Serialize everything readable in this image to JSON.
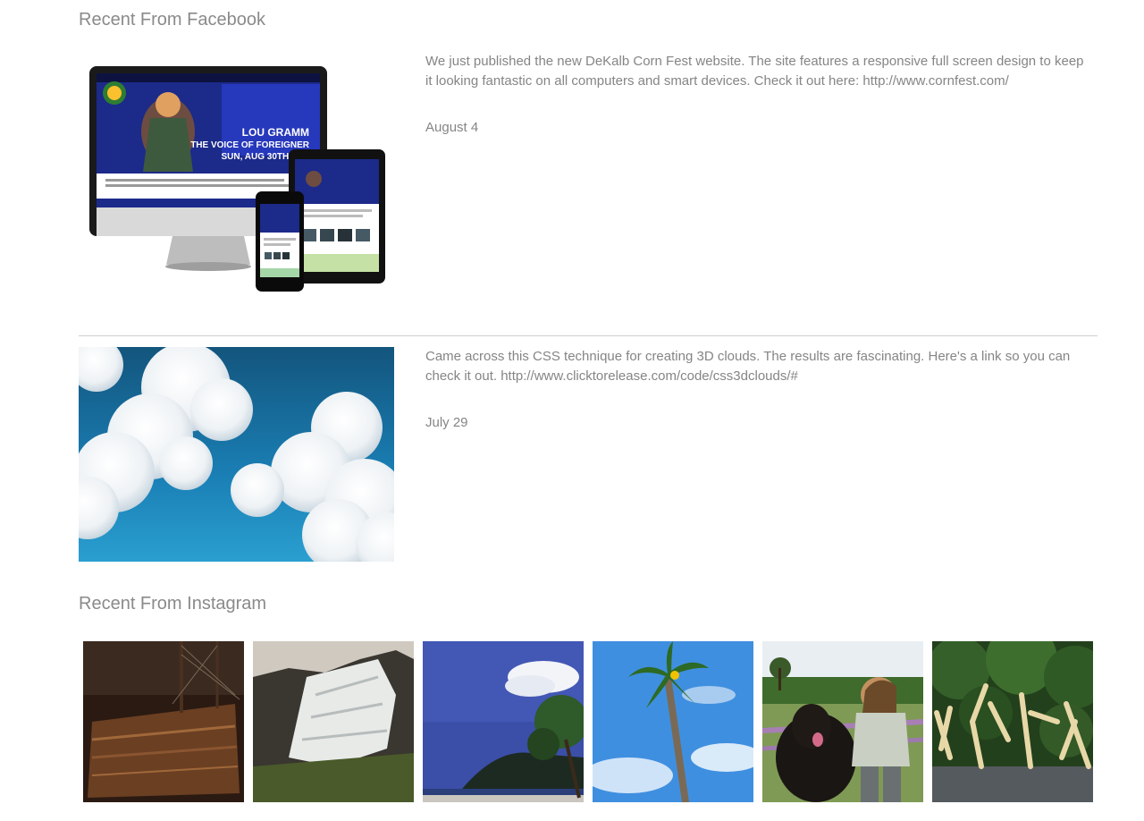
{
  "facebook": {
    "title": "Recent From Facebook",
    "posts": [
      {
        "text": "We just published the new DeKalb Corn Fest website. The site features a responsive full screen design to keep it looking fantastic on all computers and smart devices. Check it out here: http://www.cornfest.com/",
        "date": "August 4",
        "image": {
          "headline_1": "LOU GRAMM",
          "headline_2": "THE VOICE OF FOREIGNER",
          "headline_3": "SUN, AUG 30TH 4:30"
        }
      },
      {
        "text": "Came across this CSS technique for creating 3D clouds. The results are fascinating. Here's a link so you can check it out. http://www.clicktorelease.com/code/css3dclouds/#",
        "date": "July 29"
      }
    ]
  },
  "instagram": {
    "title": "Recent From Instagram",
    "photos": [
      {
        "name": "ship-photo"
      },
      {
        "name": "waterfall-photo"
      },
      {
        "name": "coast-tree-photo"
      },
      {
        "name": "palm-tree-photo"
      },
      {
        "name": "dog-woman-photo"
      },
      {
        "name": "wood-sculpture-photo"
      }
    ]
  }
}
